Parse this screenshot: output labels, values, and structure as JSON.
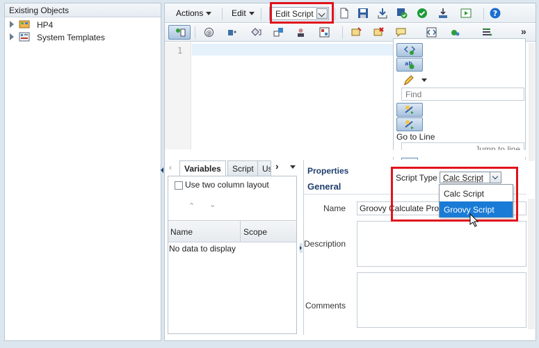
{
  "tree": {
    "header": "Existing Objects",
    "items": [
      {
        "label": "HP4"
      },
      {
        "label": "System Templates"
      }
    ]
  },
  "toolbar": {
    "actions_label": "Actions",
    "edit_label": "Edit",
    "edit_script_label": "Edit Script"
  },
  "editor": {
    "line_number": "1"
  },
  "find_panel": {
    "find_placeholder": "Find",
    "goto_label": "Go to Line",
    "jump_placeholder": "Jump to line"
  },
  "variables": {
    "tabs": [
      "Variables",
      "Script",
      "Us"
    ],
    "checkbox_label": "Use two column layout",
    "columns": [
      "Name",
      "Scope"
    ],
    "empty_text": "No data to display"
  },
  "properties": {
    "title": "Properties",
    "section": "General",
    "script_type_label": "Script Type",
    "script_type_value": "Calc Script",
    "name_label": "Name",
    "name_value": "Groovy Calculate Produc",
    "description_label": "Description",
    "comments_label": "Comments"
  },
  "script_type_options": [
    "Calc Script",
    "Groovy Script"
  ],
  "colors": {
    "highlight": "#e0121b",
    "selected": "#1a7bd6"
  }
}
